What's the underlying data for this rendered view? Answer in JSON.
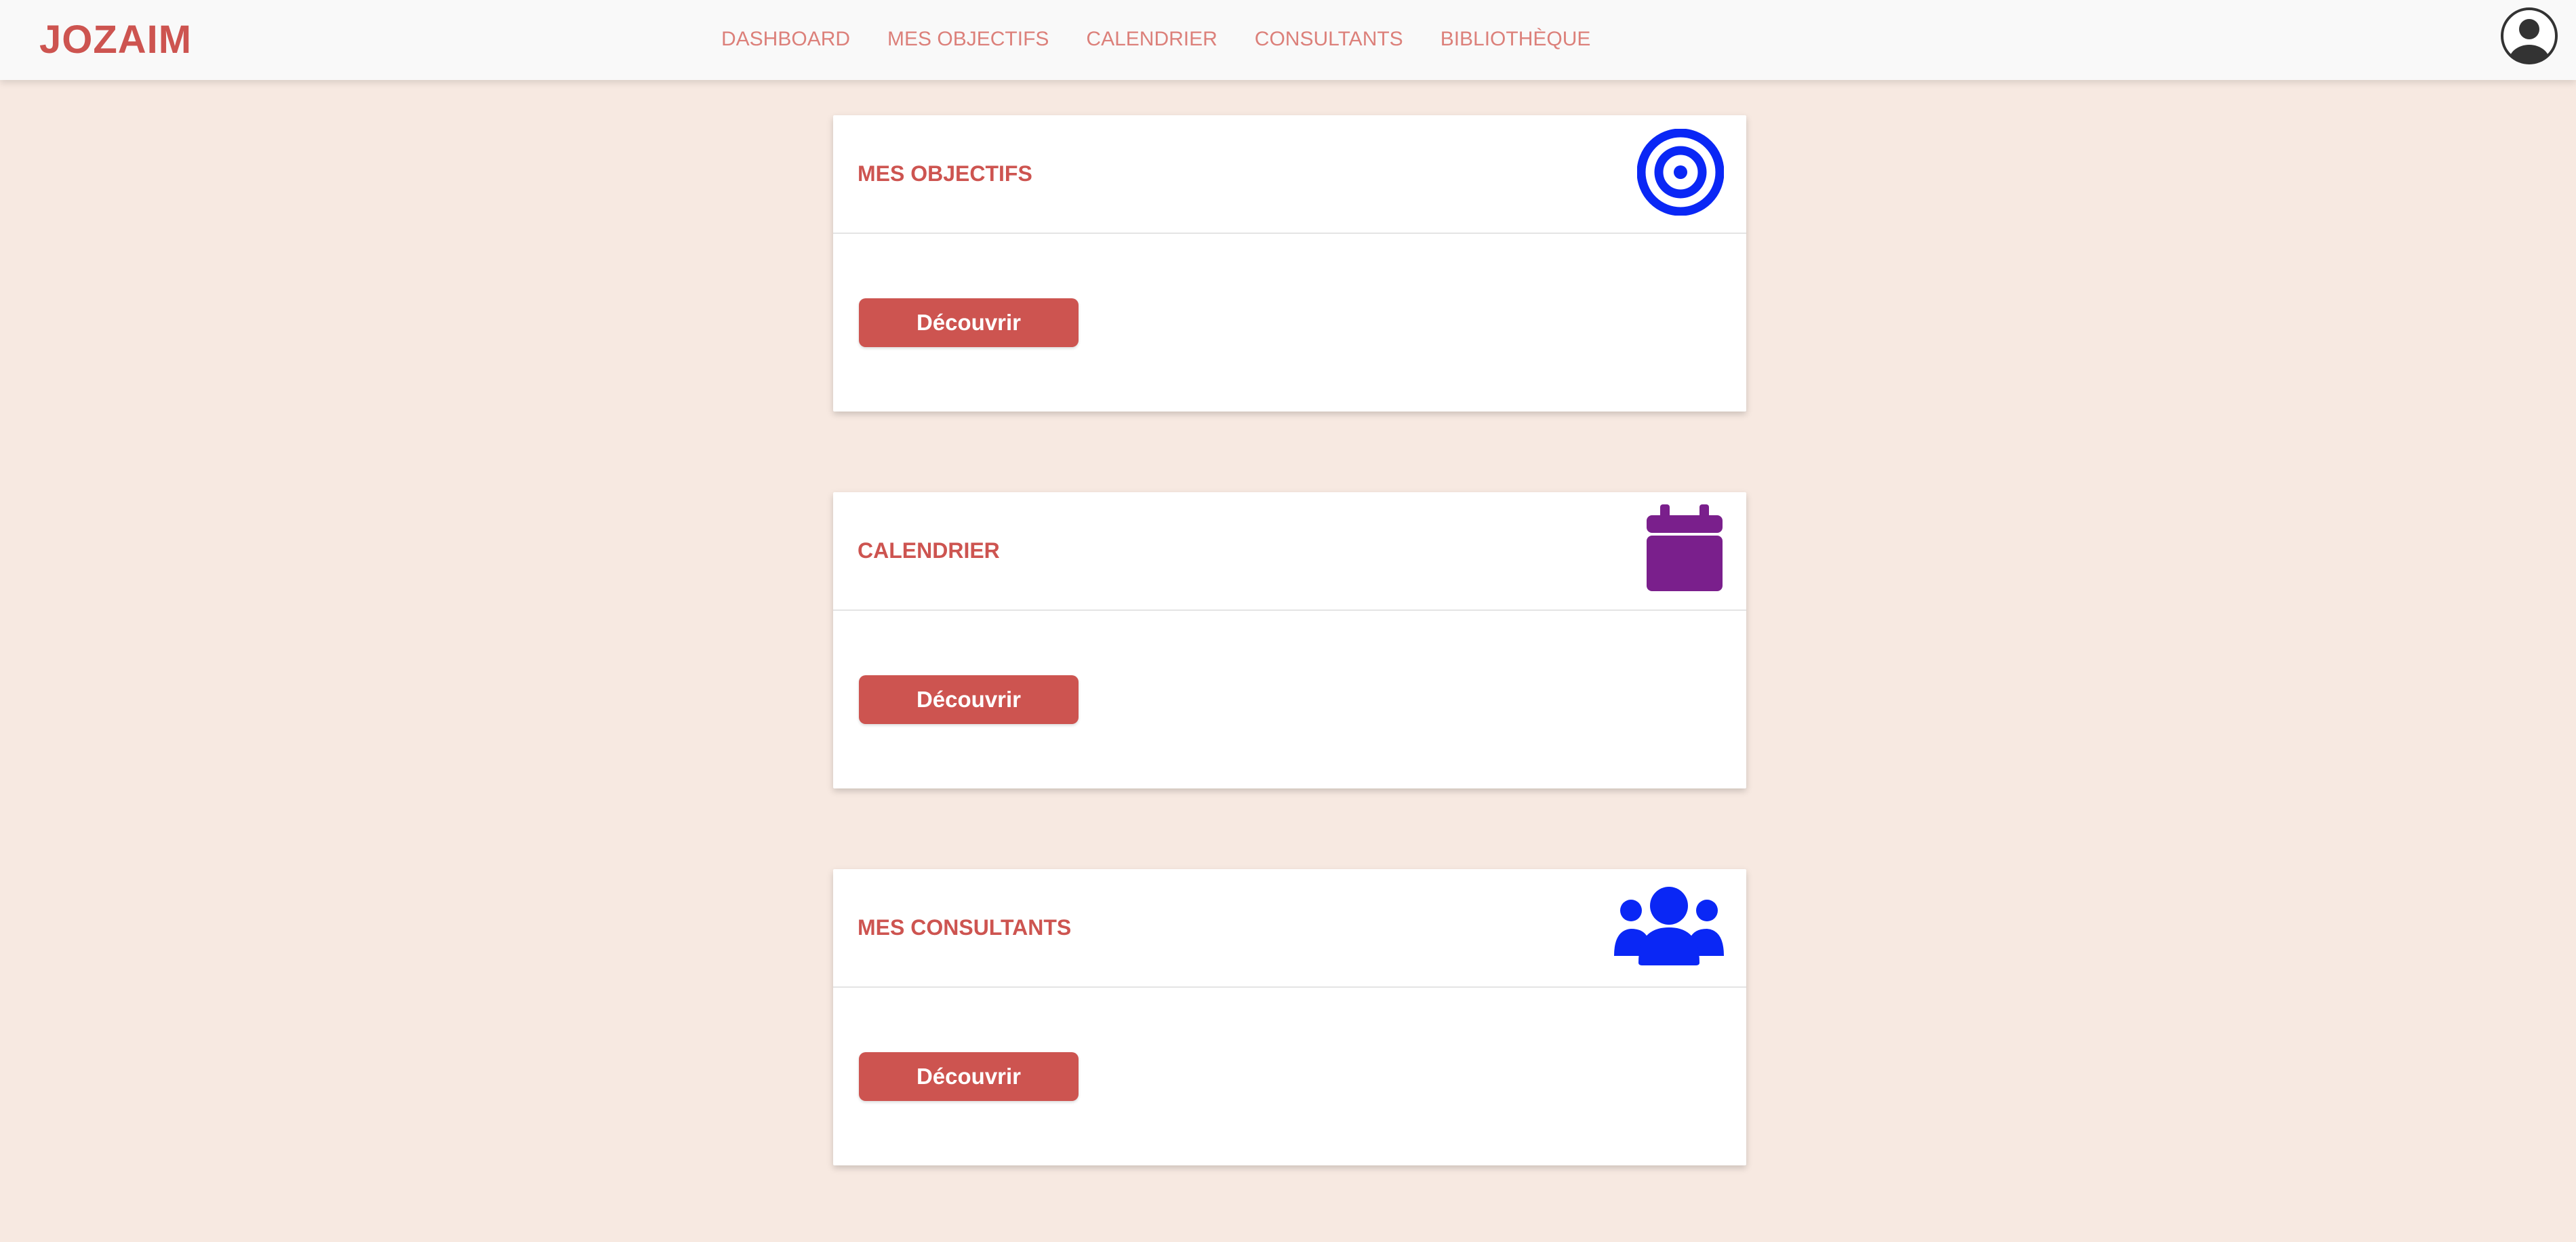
{
  "brand": "JOZAIM",
  "nav": {
    "items": [
      {
        "label": "DASHBOARD"
      },
      {
        "label": "MES OBJECTIFS"
      },
      {
        "label": "CALENDRIER"
      },
      {
        "label": "CONSULTANTS"
      },
      {
        "label": "BIBLIOTHÈQUE"
      }
    ]
  },
  "cards": [
    {
      "title": "MES OBJECTIFS",
      "icon": "target-icon",
      "button_label": "Découvrir"
    },
    {
      "title": "CALENDRIER",
      "icon": "calendar-icon",
      "button_label": "Découvrir"
    },
    {
      "title": "MES CONSULTANTS",
      "icon": "users-icon",
      "button_label": "Découvrir"
    }
  ],
  "colors": {
    "accent": "#cd5450",
    "background": "#f7e9e1",
    "target_icon": "#0a27f5",
    "calendar_icon": "#7a1f8c",
    "users_icon": "#0a27f5"
  }
}
